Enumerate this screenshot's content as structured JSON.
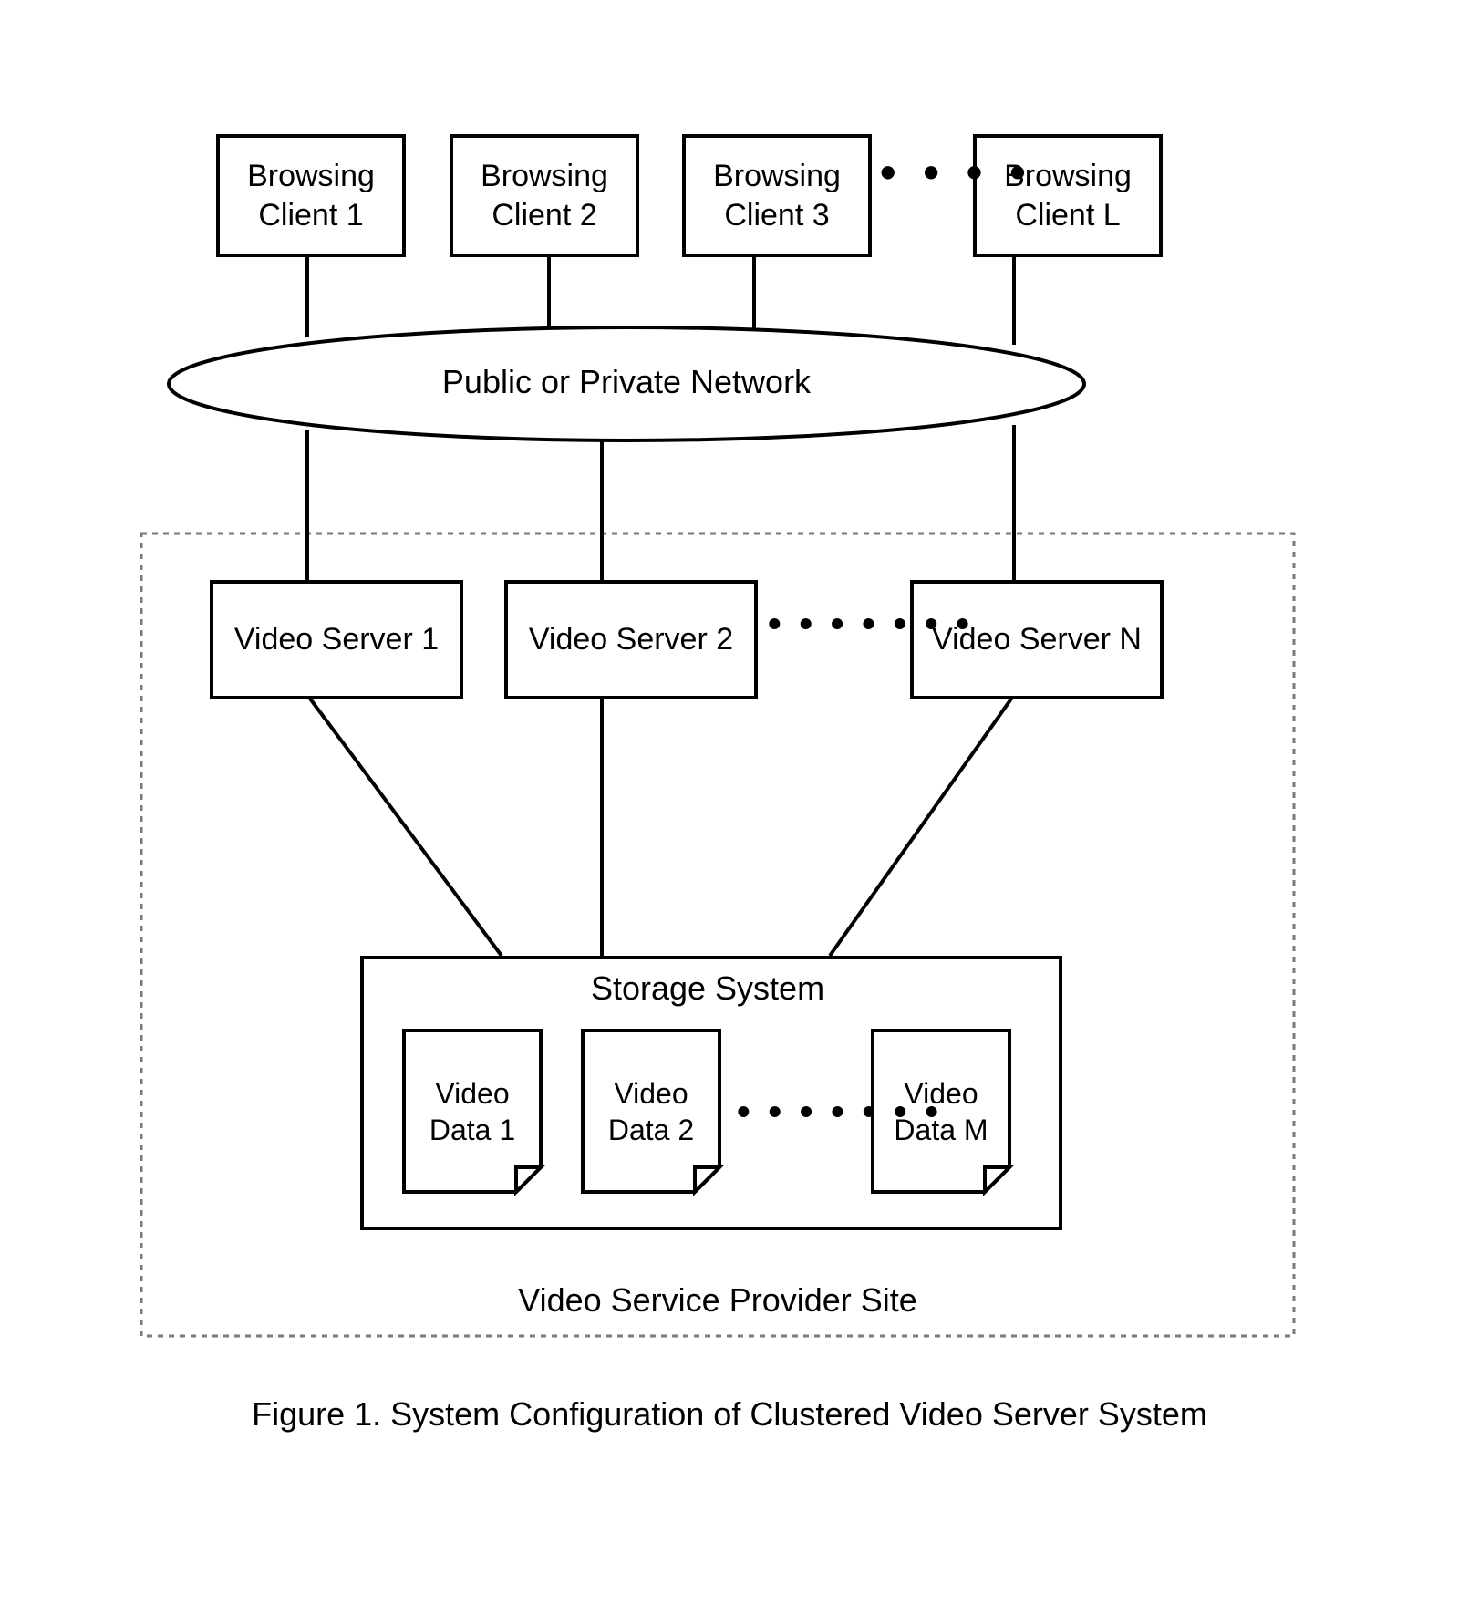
{
  "clients": [
    {
      "line1": "Browsing",
      "line2": "Client 1"
    },
    {
      "line1": "Browsing",
      "line2": "Client 2"
    },
    {
      "line1": "Browsing",
      "line2": "Client 3"
    },
    {
      "line1": "Browsing",
      "line2": "Client L"
    }
  ],
  "network_label": "Public or Private Network",
  "servers": [
    {
      "label": "Video Server 1"
    },
    {
      "label": "Video Server 2"
    },
    {
      "label": "Video Server N"
    }
  ],
  "storage_label": "Storage System",
  "data_items": [
    {
      "line1": "Video",
      "line2": "Data 1"
    },
    {
      "line1": "Video",
      "line2": "Data 2"
    },
    {
      "line1": "Video",
      "line2": "Data M"
    }
  ],
  "site_label": "Video Service Provider Site",
  "caption": "Figure 1. System Configuration of Clustered Video Server System",
  "ellipsis": "• • • •",
  "ellipsis_long": "• • • • • • •"
}
